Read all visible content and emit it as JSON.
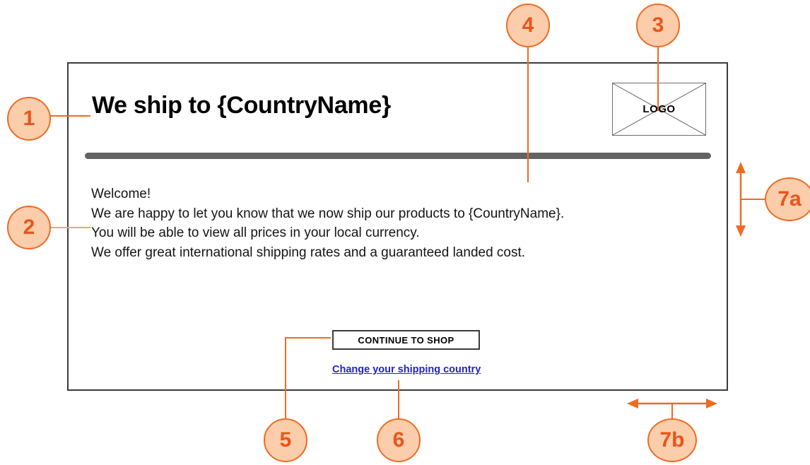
{
  "screen": {
    "title": "We ship to {CountryName}",
    "logo_label": "LOGO"
  },
  "body": {
    "lines": [
      "Welcome!",
      "We are happy to let you know that we now ship our products to {CountryName}.",
      "You will be able to view all prices in your local currency.",
      "We offer great international shipping rates and a guaranteed landed cost."
    ]
  },
  "actions": {
    "primary_button": "CONTINUE TO SHOP",
    "secondary_link": "Change your shipping country"
  },
  "callouts": [
    {
      "id": "1",
      "label": "1",
      "target": "page-title"
    },
    {
      "id": "2",
      "label": "2",
      "target": "body-copy"
    },
    {
      "id": "3",
      "label": "3",
      "target": "logo-placeholder"
    },
    {
      "id": "4",
      "label": "4",
      "target": "content-area"
    },
    {
      "id": "5",
      "label": "5",
      "target": "continue-to-shop-button"
    },
    {
      "id": "6",
      "label": "6",
      "target": "change-shipping-country-link"
    },
    {
      "id": "7a",
      "label": "7a",
      "target": "vertical-height-dimension"
    },
    {
      "id": "7b",
      "label": "7b",
      "target": "horizontal-width-dimension"
    }
  ],
  "colors": {
    "callout_fill": "#fbcdab",
    "callout_stroke": "#ef6b23",
    "callout_text": "#e8551b",
    "frame_border": "#3b3b3b",
    "divider": "#636363",
    "link": "#2222cc"
  }
}
